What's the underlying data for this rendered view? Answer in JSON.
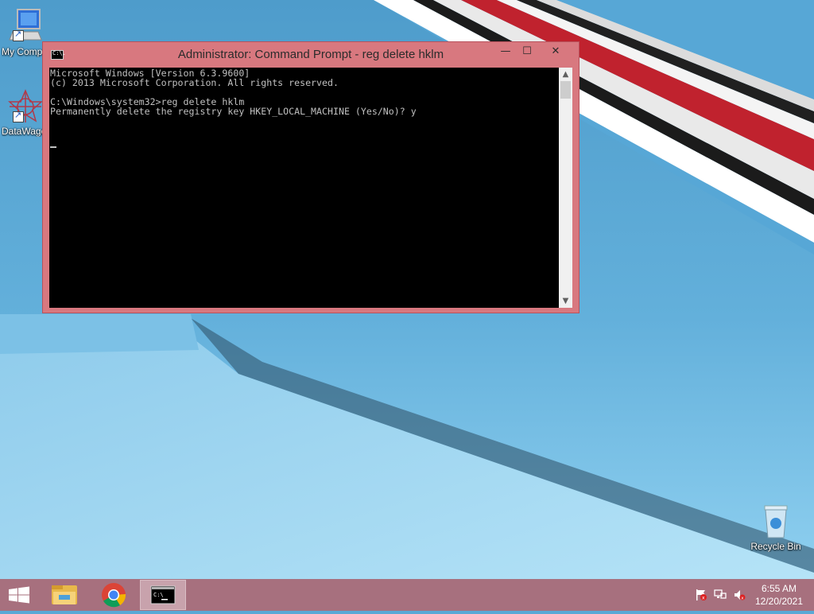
{
  "desktop": {
    "icons": [
      {
        "label": "My Computer",
        "icon": "computer-icon"
      },
      {
        "label": "DataWagon",
        "icon": "datawagon-icon"
      },
      {
        "label": "Recycle Bin",
        "icon": "recycle-bin-icon"
      }
    ]
  },
  "window": {
    "title": "Administrator: Command Prompt - reg  delete hklm",
    "app_icon_text": "C:\\.",
    "controls": {
      "minimize": "—",
      "maximize": "☐",
      "close": "✕"
    }
  },
  "console": {
    "lines": [
      "Microsoft Windows [Version 6.3.9600]",
      "(c) 2013 Microsoft Corporation. All rights reserved.",
      "",
      "C:\\Windows\\system32>reg delete hklm",
      "Permanently delete the registry key HKEY_LOCAL_MACHINE (Yes/No)? y"
    ]
  },
  "taskbar": {
    "items": [
      {
        "name": "start",
        "icon": "windows-logo-icon"
      },
      {
        "name": "file-explorer",
        "icon": "folder-icon"
      },
      {
        "name": "chrome",
        "icon": "chrome-icon"
      },
      {
        "name": "command-prompt",
        "icon": "cmd-icon",
        "active": true
      }
    ],
    "tray": [
      {
        "icon": "action-center-flag-icon"
      },
      {
        "icon": "network-icon"
      },
      {
        "icon": "volume-muted-icon"
      }
    ],
    "clock": {
      "time": "6:55 AM",
      "date": "12/20/2021"
    }
  },
  "colors": {
    "window_frame": "#d8787f",
    "taskbar": "#a7707e",
    "console_bg": "#000000",
    "console_fg": "#c0c0c0"
  }
}
